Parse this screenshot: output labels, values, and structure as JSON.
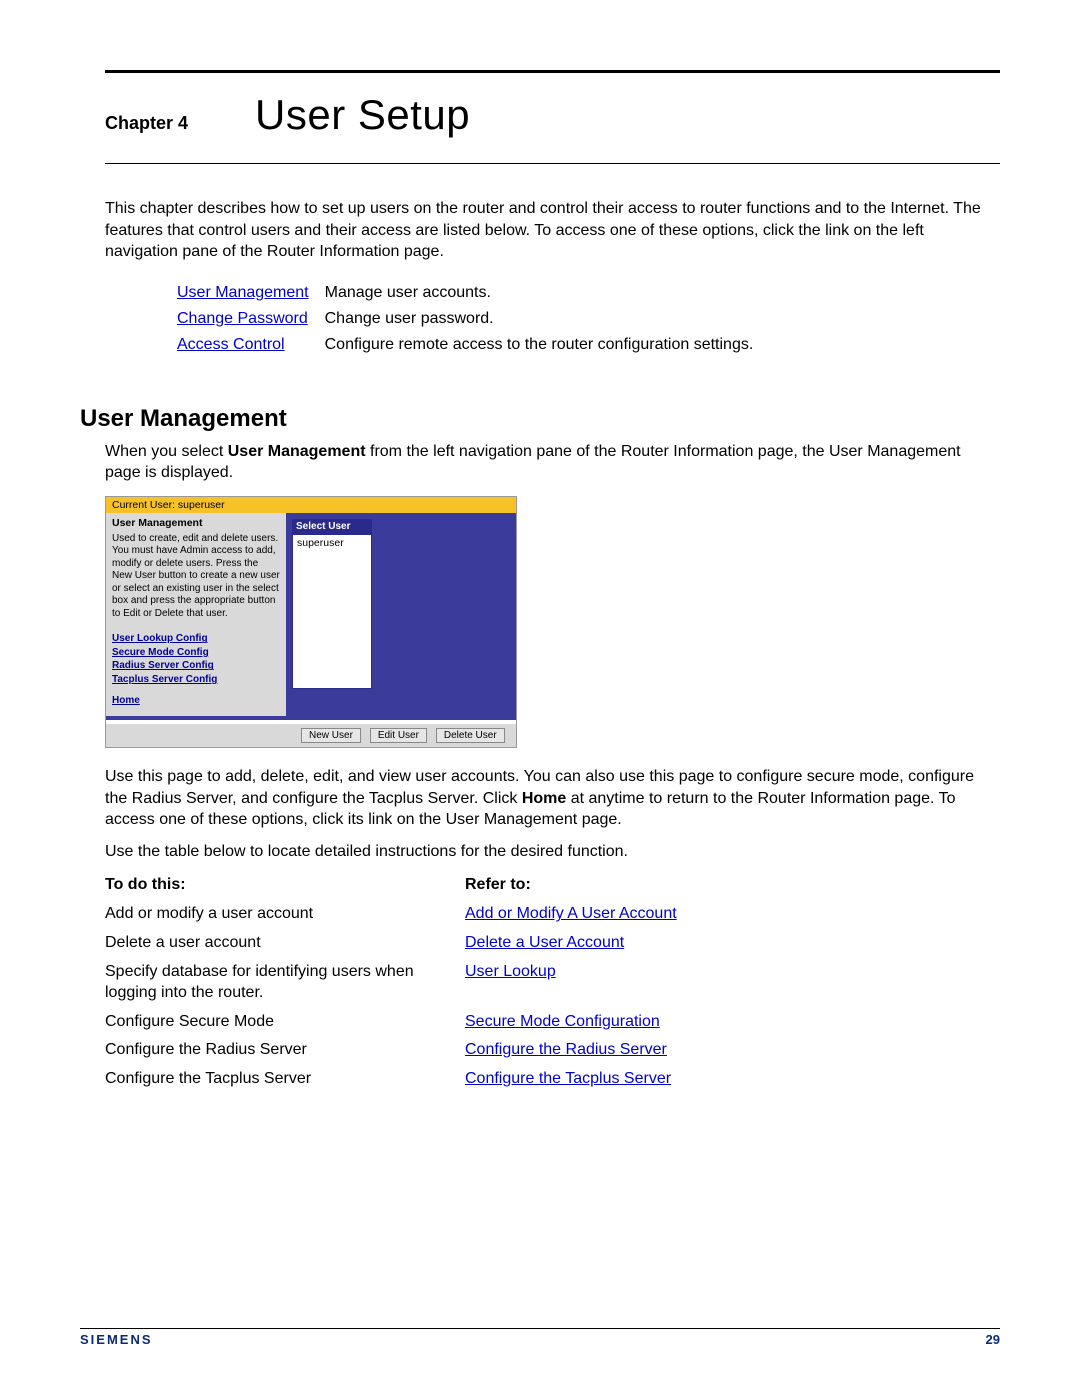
{
  "chapter_label": "Chapter 4",
  "chapter_title": "User Setup",
  "intro": "This chapter describes how to set up users on the router and control their access to router functions and to the Internet. The features that control users and their access are listed below. To access one of these options, click the link on the left navigation pane of the Router Information page.",
  "feature_links": [
    {
      "name": "User Management",
      "desc": "Manage user accounts."
    },
    {
      "name": "Change Password",
      "desc": "Change user password."
    },
    {
      "name": "Access Control",
      "desc": "Configure remote access to the router configuration settings."
    }
  ],
  "section_heading": "User Management",
  "section_intro_pre": "When you select ",
  "section_intro_bold": "User Management",
  "section_intro_post": " from the left navigation pane of the Router Information page, the User Management page is displayed.",
  "ui": {
    "current_user": "Current User: superuser",
    "panel_title": "User Management",
    "panel_text": "Used to create, edit and delete users. You must have Admin access to add, modify or delete users. Press the New User button to create a new user or select an existing user in the select box and press the appropriate button to Edit or Delete that user.",
    "left_links": [
      "User Lookup Config",
      "Secure Mode Config",
      "Radius Server Config",
      "Tacplus Server Config"
    ],
    "home_link": "Home",
    "select_user_header": "Select User",
    "select_user_item": "superuser",
    "buttons": {
      "new": "New User",
      "edit": "Edit User",
      "del": "Delete User"
    }
  },
  "after_ui_p1_pre": "Use this page to add, delete, edit, and view user accounts. You can also use this page to configure secure mode, configure the Radius Server, and configure the Tacplus Server. Click ",
  "after_ui_p1_bold": "Home",
  "after_ui_p1_post": " at anytime to return to the Router Information page. To access one of these options, click its link on the User Management page.",
  "after_ui_p2": "Use the table below to locate detailed instructions for the desired function.",
  "ref_table": {
    "col1": "To do this:",
    "col2": "Refer to:",
    "rows": [
      {
        "todo": "Add or modify a user account",
        "ref": "Add or Modify A User Account"
      },
      {
        "todo": "Delete a user account",
        "ref": "Delete a User Account"
      },
      {
        "todo": "Specify database for identifying users when logging into the router.",
        "ref": "User Lookup"
      },
      {
        "todo": "Configure Secure Mode",
        "ref": "Secure Mode Configuration"
      },
      {
        "todo": "Configure the Radius Server",
        "ref": "Configure the Radius Server"
      },
      {
        "todo": "Configure the Tacplus Server",
        "ref": "Configure the Tacplus Server"
      }
    ]
  },
  "footer": {
    "brand": "SIEMENS",
    "page": "29"
  }
}
